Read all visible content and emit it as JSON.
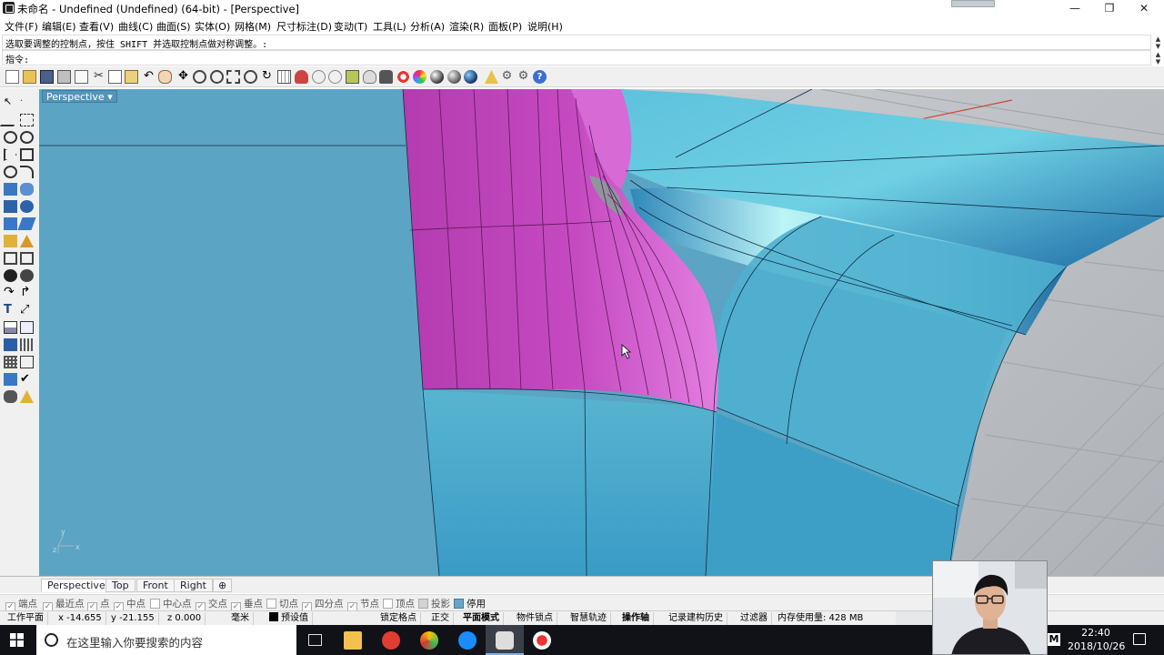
{
  "window": {
    "title": "未命名 - Undefined (Undefined) (64-bit) - [Perspective]",
    "controls": {
      "minimize": "—",
      "maximize": "❐",
      "close": "✕"
    }
  },
  "menu": [
    "文件(F)",
    "编辑(E)",
    "查看(V)",
    "曲线(C)",
    "曲面(S)",
    "实体(O)",
    "网格(M)",
    "尺寸标注(D)",
    "变动(T)",
    "工具(L)",
    "分析(A)",
    "渲染(R)",
    "面板(P)",
    "说明(H)"
  ],
  "command": {
    "history": "选取要调整的控制点，按住 SHIFT 并选取控制点做对称调整。:",
    "prompt": "指令:"
  },
  "viewport": {
    "label": "Perspective",
    "label_arrow": "▾",
    "axis_x": "x",
    "axis_y": "y",
    "axis_z": "z"
  },
  "viewport_tabs": [
    "Perspective",
    "Top",
    "Front",
    "Right"
  ],
  "viewport_tab_add": "⊕",
  "osnaps": [
    {
      "label": "端点",
      "checked": true
    },
    {
      "label": "最近点",
      "checked": true
    },
    {
      "label": "点",
      "checked": true
    },
    {
      "label": "中点",
      "checked": true
    },
    {
      "label": "中心点",
      "checked": false
    },
    {
      "label": "交点",
      "checked": true
    },
    {
      "label": "垂点",
      "checked": true
    },
    {
      "label": "切点",
      "checked": false
    },
    {
      "label": "四分点",
      "checked": true
    },
    {
      "label": "节点",
      "checked": true
    },
    {
      "label": "顶点",
      "checked": false
    },
    {
      "label": "投影",
      "checked": false
    },
    {
      "label": "停用",
      "checked": true
    }
  ],
  "status": {
    "cplane": "工作平面",
    "x": "x -14.655",
    "y": "y -21.155",
    "z": "z 0.000",
    "units": "毫米",
    "layer": "预设值",
    "grid_snap": "锁定格点",
    "ortho": "正交",
    "planar": "平面模式",
    "osnap": "物件锁点",
    "smarttrack": "智慧轨迹",
    "gumball": "操作轴",
    "history": "记录建构历史",
    "filter": "过滤器",
    "memory": "内存使用量: 428 MB"
  },
  "taskbar": {
    "search_placeholder": "在这里输入你要搜索的内容",
    "time": "22:40",
    "date": "2018/10/26"
  },
  "colors": {
    "viewport_bg": "#5ba4c3",
    "surface_magenta": "#c23fbd",
    "surface_cyan": "#3fa0cc",
    "grid_plane": "#b8bcc1"
  }
}
